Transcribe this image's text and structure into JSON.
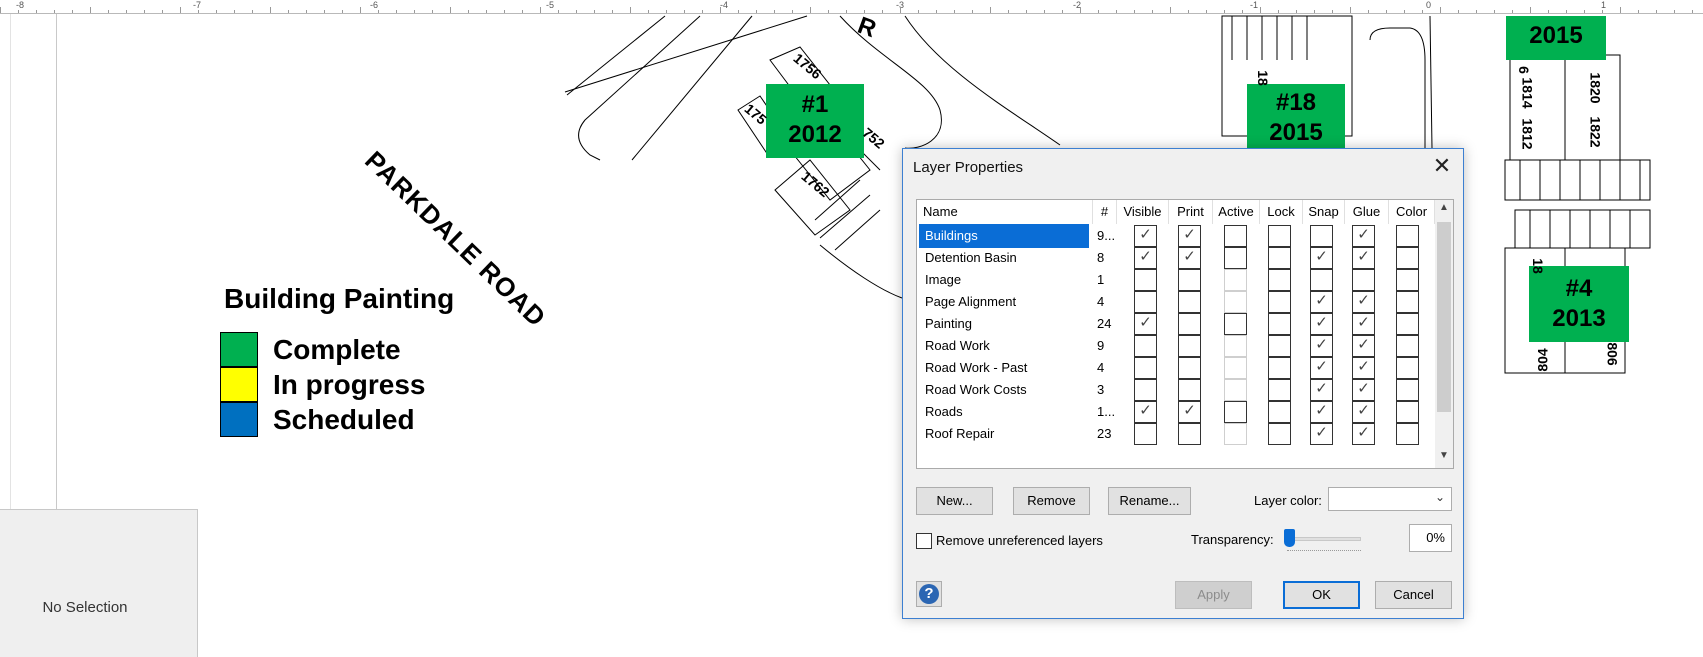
{
  "ruler": {
    "labels": [
      "-8",
      "-7",
      "-6",
      "-5",
      "-4",
      "-3",
      "-2",
      "-1",
      "0",
      "1"
    ]
  },
  "drawing": {
    "road_name": "PARKDALE ROAD",
    "road_fragment": "R",
    "tags": [
      {
        "line1": "#1",
        "line2": "2012"
      },
      {
        "line1": "#18",
        "line2": "2015"
      },
      {
        "line1": "",
        "line2": "2015"
      },
      {
        "line1": "#4",
        "line2": "2013"
      }
    ],
    "lot_numbers": [
      "1756",
      "175",
      "752",
      "1762",
      "18",
      "18",
      "6",
      "1814",
      "1812",
      "1820",
      "1822",
      "804",
      "806"
    ],
    "tag_color": "#00b050"
  },
  "legend": {
    "title": "Building Painting",
    "items": [
      {
        "label": "Complete",
        "color": "#00b050"
      },
      {
        "label": "In progress",
        "color": "#ffff00"
      },
      {
        "label": "Scheduled",
        "color": "#0070c0"
      }
    ]
  },
  "side_panel": {
    "text": "No Selection"
  },
  "dialog": {
    "title": "Layer Properties",
    "columns": [
      "Name",
      "#",
      "Visible",
      "Print",
      "Active",
      "Lock",
      "Snap",
      "Glue",
      "Color"
    ],
    "rows": [
      {
        "name": "Buildings",
        "count": "9...",
        "visible": true,
        "print": true,
        "active": false,
        "active_enabled": true,
        "lock": false,
        "snap": false,
        "glue": true,
        "color": false,
        "selected": true
      },
      {
        "name": "Detention Basin",
        "count": "8",
        "visible": true,
        "print": true,
        "active": false,
        "active_enabled": true,
        "lock": false,
        "snap": true,
        "glue": true,
        "color": false
      },
      {
        "name": "Image",
        "count": "1",
        "visible": false,
        "print": false,
        "active": false,
        "active_enabled": false,
        "lock": false,
        "snap": false,
        "glue": false,
        "color": false
      },
      {
        "name": "Page Alignment",
        "count": "4",
        "visible": false,
        "print": false,
        "active": false,
        "active_enabled": false,
        "lock": false,
        "snap": true,
        "glue": true,
        "color": false
      },
      {
        "name": "Painting",
        "count": "24",
        "visible": true,
        "print": false,
        "active": false,
        "active_enabled": true,
        "lock": false,
        "snap": true,
        "glue": true,
        "color": false
      },
      {
        "name": "Road Work",
        "count": "9",
        "visible": false,
        "print": false,
        "active": false,
        "active_enabled": false,
        "lock": false,
        "snap": true,
        "glue": true,
        "color": false
      },
      {
        "name": "Road Work - Past",
        "count": "4",
        "visible": false,
        "print": false,
        "active": false,
        "active_enabled": false,
        "lock": false,
        "snap": true,
        "glue": true,
        "color": false
      },
      {
        "name": "Road Work Costs",
        "count": "3",
        "visible": false,
        "print": false,
        "active": false,
        "active_enabled": false,
        "lock": false,
        "snap": true,
        "glue": true,
        "color": false
      },
      {
        "name": "Roads",
        "count": "1...",
        "visible": true,
        "print": true,
        "active": false,
        "active_enabled": true,
        "lock": false,
        "snap": true,
        "glue": true,
        "color": false
      },
      {
        "name": "Roof Repair",
        "count": "23",
        "visible": false,
        "print": false,
        "active": false,
        "active_enabled": false,
        "lock": false,
        "snap": true,
        "glue": true,
        "color": false
      }
    ],
    "buttons": {
      "new": "New...",
      "remove": "Remove",
      "rename": "Rename...",
      "apply": "Apply",
      "ok": "OK",
      "cancel": "Cancel"
    },
    "layer_color_label": "Layer color:",
    "layer_color_value": "",
    "remove_unreferenced_label": "Remove unreferenced layers",
    "remove_unreferenced_checked": false,
    "transparency_label": "Transparency:",
    "transparency_value": "0%",
    "accent": "#0a6dd6"
  }
}
